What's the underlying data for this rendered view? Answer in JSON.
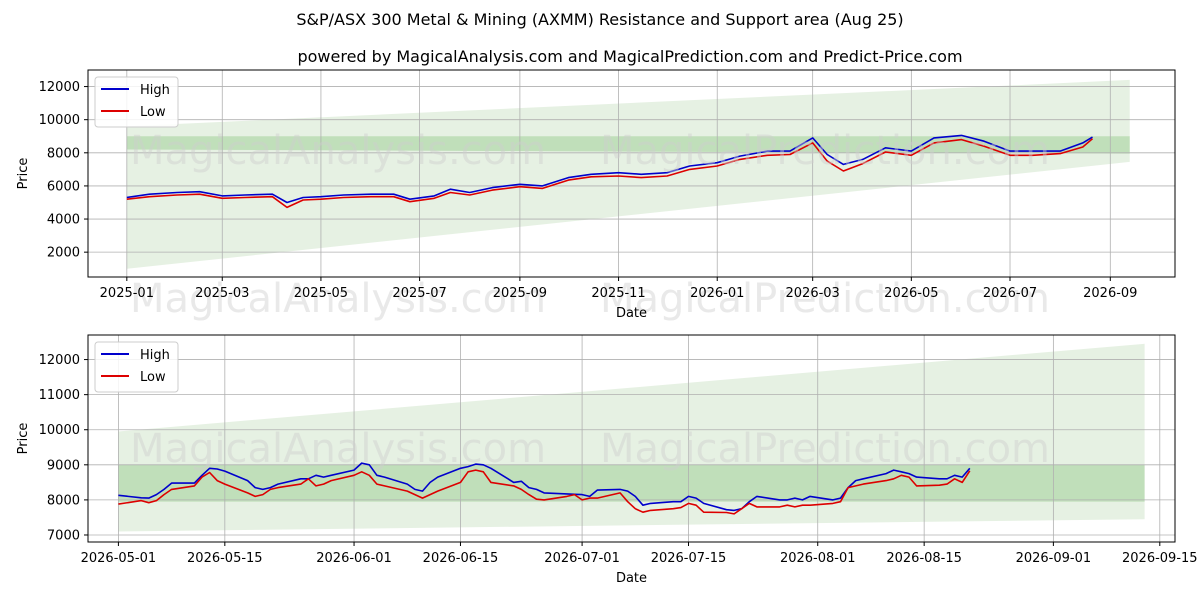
{
  "title": "S&P/ASX 300 Metal & Mining (AXMM) Resistance and Support area (Aug 25)",
  "subtitle": "powered by MagicalAnalysis.com and MagicalPrediction.com and Predict-Price.com",
  "watermarks": [
    "MagicalAnalysis.com",
    "MagicalPrediction.com"
  ],
  "colors": {
    "high": "#0000cc",
    "low": "#dd0000",
    "band_light": "#e3f0e0",
    "band_mid": "#b9dcb3"
  },
  "chart_data": [
    {
      "type": "line",
      "xlabel": "Date",
      "ylabel": "Price",
      "xlim": [
        "2024-12-08",
        "2026-10-11"
      ],
      "ylim": [
        500,
        13000
      ],
      "xticks": [
        "2025-01",
        "2025-03",
        "2025-05",
        "2025-07",
        "2025-09",
        "2025-11",
        "2026-01",
        "2026-03",
        "2026-05",
        "2026-07",
        "2026-09"
      ],
      "xtick_dates": [
        "2025-01-01",
        "2025-03-01",
        "2025-05-01",
        "2025-07-01",
        "2025-09-01",
        "2025-11-01",
        "2026-01-01",
        "2026-03-01",
        "2026-05-01",
        "2026-07-01",
        "2026-09-01"
      ],
      "yticks": [
        "2000",
        "4000",
        "6000",
        "8000",
        "10000",
        "12000"
      ],
      "ytick_values": [
        2000,
        4000,
        6000,
        8000,
        10000,
        12000
      ],
      "grid": true,
      "legend": "top-left",
      "series": [
        {
          "name": "High",
          "x": [
            "2025-01-01",
            "2025-01-15",
            "2025-02-01",
            "2025-02-15",
            "2025-03-01",
            "2025-03-15",
            "2025-04-01",
            "2025-04-10",
            "2025-04-20",
            "2025-05-01",
            "2025-05-15",
            "2025-06-01",
            "2025-06-15",
            "2025-06-25",
            "2025-07-10",
            "2025-07-20",
            "2025-08-01",
            "2025-08-15",
            "2025-09-01",
            "2025-09-15",
            "2025-10-01",
            "2025-10-15",
            "2025-11-01",
            "2025-11-15",
            "2025-12-01",
            "2025-12-15",
            "2026-01-01",
            "2026-01-15",
            "2026-02-01",
            "2026-02-15",
            "2026-03-01",
            "2026-03-10",
            "2026-03-20",
            "2026-04-01",
            "2026-04-15",
            "2026-05-01",
            "2026-05-15",
            "2026-06-01",
            "2026-06-15",
            "2026-07-01",
            "2026-07-15",
            "2026-08-01",
            "2026-08-15",
            "2026-08-21"
          ],
          "values": [
            5300,
            5500,
            5600,
            5650,
            5400,
            5450,
            5500,
            5000,
            5300,
            5350,
            5450,
            5500,
            5500,
            5200,
            5400,
            5800,
            5600,
            5900,
            6100,
            6000,
            6500,
            6700,
            6800,
            6700,
            6800,
            7200,
            7400,
            7800,
            8100,
            8100,
            8900,
            7900,
            7300,
            7600,
            8300,
            8100,
            8900,
            9050,
            8700,
            8100,
            8100,
            8100,
            8600,
            8950
          ]
        },
        {
          "name": "Low",
          "x": [
            "2025-01-01",
            "2025-01-15",
            "2025-02-01",
            "2025-02-15",
            "2025-03-01",
            "2025-03-15",
            "2025-04-01",
            "2025-04-10",
            "2025-04-20",
            "2025-05-01",
            "2025-05-15",
            "2025-06-01",
            "2025-06-15",
            "2025-06-25",
            "2025-07-10",
            "2025-07-20",
            "2025-08-01",
            "2025-08-15",
            "2025-09-01",
            "2025-09-15",
            "2025-10-01",
            "2025-10-15",
            "2025-11-01",
            "2025-11-15",
            "2025-12-01",
            "2025-12-15",
            "2026-01-01",
            "2026-01-15",
            "2026-02-01",
            "2026-02-15",
            "2026-03-01",
            "2026-03-10",
            "2026-03-20",
            "2026-04-01",
            "2026-04-15",
            "2026-05-01",
            "2026-05-15",
            "2026-06-01",
            "2026-06-15",
            "2026-07-01",
            "2026-07-15",
            "2026-08-01",
            "2026-08-15",
            "2026-08-21"
          ],
          "values": [
            5200,
            5350,
            5450,
            5500,
            5250,
            5300,
            5350,
            4700,
            5150,
            5200,
            5300,
            5350,
            5350,
            5050,
            5250,
            5600,
            5450,
            5750,
            5950,
            5850,
            6350,
            6550,
            6600,
            6500,
            6600,
            7000,
            7200,
            7600,
            7850,
            7900,
            8600,
            7500,
            6900,
            7350,
            8050,
            7850,
            8600,
            8800,
            8400,
            7850,
            7850,
            7950,
            8350,
            8850
          ]
        }
      ],
      "bands": [
        {
          "x": [
            "2025-01-01",
            "2026-09-13"
          ],
          "upper": [
            9600,
            12400
          ],
          "lower": [
            1000,
            7450
          ]
        },
        {
          "x": [
            "2025-01-01",
            "2026-09-13"
          ],
          "upper": [
            9000,
            9000
          ],
          "lower": [
            8200,
            7950
          ]
        }
      ]
    },
    {
      "type": "line",
      "xlabel": "Date",
      "ylabel": "Price",
      "xlim": [
        "2026-04-27",
        "2026-09-17"
      ],
      "ylim": [
        6800,
        12700
      ],
      "xticks": [
        "2026-05-01",
        "2026-05-15",
        "2026-06-01",
        "2026-06-15",
        "2026-07-01",
        "2026-07-15",
        "2026-08-01",
        "2026-08-15",
        "2026-09-01",
        "2026-09-15"
      ],
      "xtick_dates": [
        "2026-05-01",
        "2026-05-15",
        "2026-06-01",
        "2026-06-15",
        "2026-07-01",
        "2026-07-15",
        "2026-08-01",
        "2026-08-15",
        "2026-09-01",
        "2026-09-15"
      ],
      "yticks": [
        "7000",
        "8000",
        "9000",
        "10000",
        "11000",
        "12000"
      ],
      "ytick_values": [
        7000,
        8000,
        9000,
        10000,
        11000,
        12000
      ],
      "grid": true,
      "legend": "top-left",
      "series": [
        {
          "name": "High",
          "x": [
            "2026-05-01",
            "2026-05-04",
            "2026-05-05",
            "2026-05-06",
            "2026-05-07",
            "2026-05-08",
            "2026-05-11",
            "2026-05-12",
            "2026-05-13",
            "2026-05-14",
            "2026-05-15",
            "2026-05-18",
            "2026-05-19",
            "2026-05-20",
            "2026-05-21",
            "2026-05-22",
            "2026-05-25",
            "2026-05-26",
            "2026-05-27",
            "2026-05-28",
            "2026-05-29",
            "2026-06-01",
            "2026-06-02",
            "2026-06-03",
            "2026-06-04",
            "2026-06-05",
            "2026-06-08",
            "2026-06-09",
            "2026-06-10",
            "2026-06-11",
            "2026-06-12",
            "2026-06-15",
            "2026-06-16",
            "2026-06-17",
            "2026-06-18",
            "2026-06-19",
            "2026-06-22",
            "2026-06-23",
            "2026-06-24",
            "2026-06-25",
            "2026-06-26",
            "2026-06-29",
            "2026-06-30",
            "2026-07-01",
            "2026-07-02",
            "2026-07-03",
            "2026-07-06",
            "2026-07-07",
            "2026-07-08",
            "2026-07-09",
            "2026-07-10",
            "2026-07-13",
            "2026-07-14",
            "2026-07-15",
            "2026-07-16",
            "2026-07-17",
            "2026-07-20",
            "2026-07-21",
            "2026-07-22",
            "2026-07-23",
            "2026-07-24",
            "2026-07-27",
            "2026-07-28",
            "2026-07-29",
            "2026-07-30",
            "2026-07-31",
            "2026-08-03",
            "2026-08-04",
            "2026-08-05",
            "2026-08-06",
            "2026-08-07",
            "2026-08-10",
            "2026-08-11",
            "2026-08-12",
            "2026-08-13",
            "2026-08-14",
            "2026-08-17",
            "2026-08-18",
            "2026-08-19",
            "2026-08-20",
            "2026-08-21"
          ],
          "values": [
            8130,
            8060,
            8050,
            8150,
            8300,
            8480,
            8480,
            8700,
            8900,
            8880,
            8820,
            8550,
            8350,
            8300,
            8350,
            8450,
            8600,
            8600,
            8700,
            8650,
            8700,
            8850,
            9050,
            9000,
            8700,
            8650,
            8450,
            8300,
            8250,
            8500,
            8650,
            8900,
            8950,
            9020,
            9000,
            8900,
            8500,
            8530,
            8350,
            8300,
            8200,
            8170,
            8160,
            8150,
            8100,
            8280,
            8300,
            8250,
            8100,
            7850,
            7900,
            7950,
            7950,
            8100,
            8050,
            7900,
            7720,
            7700,
            7750,
            7950,
            8100,
            8000,
            8000,
            8050,
            8000,
            8100,
            8000,
            8050,
            8350,
            8550,
            8600,
            8750,
            8850,
            8800,
            8750,
            8650,
            8600,
            8600,
            8700,
            8650,
            8900
          ]
        },
        {
          "name": "Low",
          "x": [
            "2026-05-01",
            "2026-05-04",
            "2026-05-05",
            "2026-05-06",
            "2026-05-07",
            "2026-05-08",
            "2026-05-11",
            "2026-05-12",
            "2026-05-13",
            "2026-05-14",
            "2026-05-15",
            "2026-05-18",
            "2026-05-19",
            "2026-05-20",
            "2026-05-21",
            "2026-05-22",
            "2026-05-25",
            "2026-05-26",
            "2026-05-27",
            "2026-05-28",
            "2026-05-29",
            "2026-06-01",
            "2026-06-02",
            "2026-06-03",
            "2026-06-04",
            "2026-06-05",
            "2026-06-08",
            "2026-06-09",
            "2026-06-10",
            "2026-06-11",
            "2026-06-12",
            "2026-06-15",
            "2026-06-16",
            "2026-06-17",
            "2026-06-18",
            "2026-06-19",
            "2026-06-22",
            "2026-06-23",
            "2026-06-24",
            "2026-06-25",
            "2026-06-26",
            "2026-06-29",
            "2026-06-30",
            "2026-07-01",
            "2026-07-02",
            "2026-07-03",
            "2026-07-06",
            "2026-07-07",
            "2026-07-08",
            "2026-07-09",
            "2026-07-10",
            "2026-07-13",
            "2026-07-14",
            "2026-07-15",
            "2026-07-16",
            "2026-07-17",
            "2026-07-20",
            "2026-07-21",
            "2026-07-22",
            "2026-07-23",
            "2026-07-24",
            "2026-07-27",
            "2026-07-28",
            "2026-07-29",
            "2026-07-30",
            "2026-07-31",
            "2026-08-03",
            "2026-08-04",
            "2026-08-05",
            "2026-08-06",
            "2026-08-07",
            "2026-08-10",
            "2026-08-11",
            "2026-08-12",
            "2026-08-13",
            "2026-08-14",
            "2026-08-17",
            "2026-08-18",
            "2026-08-19",
            "2026-08-20",
            "2026-08-21"
          ],
          "values": [
            7880,
            7980,
            7920,
            7980,
            8150,
            8300,
            8400,
            8650,
            8780,
            8550,
            8450,
            8200,
            8100,
            8150,
            8300,
            8350,
            8450,
            8600,
            8400,
            8450,
            8550,
            8700,
            8800,
            8700,
            8450,
            8400,
            8250,
            8150,
            8050,
            8150,
            8250,
            8500,
            8800,
            8850,
            8800,
            8500,
            8400,
            8300,
            8150,
            8020,
            8000,
            8100,
            8150,
            8000,
            8050,
            8050,
            8200,
            7950,
            7750,
            7650,
            7700,
            7750,
            7780,
            7900,
            7850,
            7650,
            7640,
            7600,
            7750,
            7900,
            7800,
            7800,
            7850,
            7800,
            7850,
            7850,
            7900,
            7950,
            8350,
            8400,
            8450,
            8550,
            8600,
            8700,
            8650,
            8400,
            8420,
            8450,
            8600,
            8500,
            8830
          ]
        }
      ],
      "bands": [
        {
          "x": [
            "2026-05-01",
            "2026-09-13"
          ],
          "upper": [
            9950,
            12450
          ],
          "lower": [
            7100,
            7450
          ]
        },
        {
          "x": [
            "2026-05-01",
            "2026-09-13"
          ],
          "upper": [
            9000,
            9000
          ],
          "lower": [
            7950,
            7950
          ]
        }
      ]
    }
  ]
}
